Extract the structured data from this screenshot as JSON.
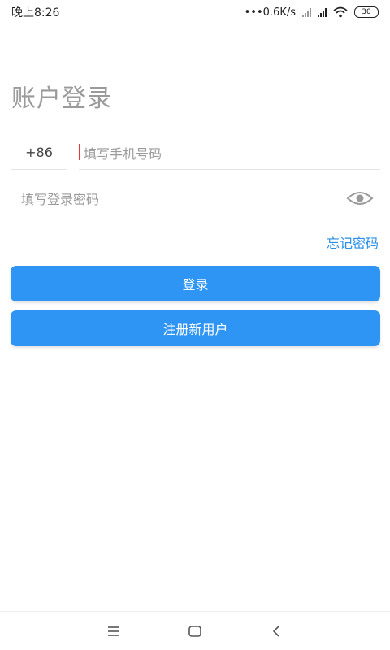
{
  "status_bar": {
    "time": "晚上8:26",
    "network_speed": "•••0.6K/s",
    "battery": "30"
  },
  "login": {
    "title": "账户登录",
    "country_code": "+86",
    "phone_placeholder": "填写手机号码",
    "password_placeholder": "填写登录密码",
    "forgot_password": "忘记密码",
    "login_button": "登录",
    "register_button": "注册新用户"
  },
  "colors": {
    "accent": "#2f95f5",
    "link": "#2a8fe8",
    "caret": "#e53935"
  },
  "icons": {
    "password_toggle": "eye-icon",
    "nav_menu": "menu-icon",
    "nav_home": "home-square-icon",
    "nav_back": "back-chevron-icon"
  }
}
